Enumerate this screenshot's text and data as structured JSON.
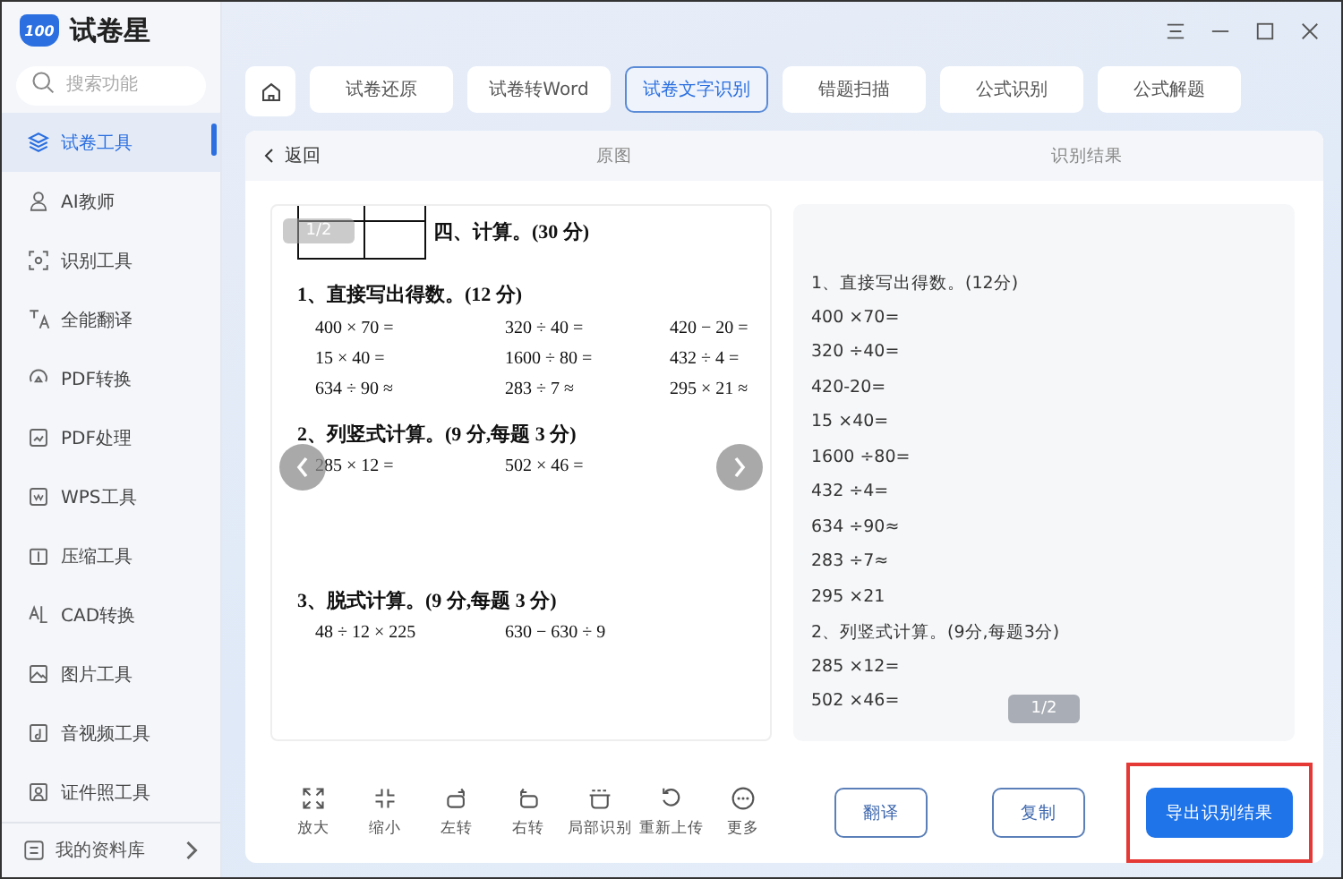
{
  "app": {
    "name": "试卷星",
    "logo_badge": "100"
  },
  "search": {
    "placeholder": "搜索功能"
  },
  "sidebar": {
    "items": [
      {
        "label": "试卷工具",
        "selected": true
      },
      {
        "label": "AI教师",
        "selected": false
      },
      {
        "label": "识别工具",
        "selected": false
      },
      {
        "label": "全能翻译",
        "selected": false
      },
      {
        "label": "PDF转换",
        "selected": false
      },
      {
        "label": "PDF处理",
        "selected": false
      },
      {
        "label": "WPS工具",
        "selected": false
      },
      {
        "label": "压缩工具",
        "selected": false
      },
      {
        "label": "CAD转换",
        "selected": false
      },
      {
        "label": "图片工具",
        "selected": false
      },
      {
        "label": "音视频工具",
        "selected": false
      },
      {
        "label": "证件照工具",
        "selected": false
      }
    ],
    "footer": "我的资料库"
  },
  "tabs": [
    {
      "label": "试卷还原",
      "selected": false
    },
    {
      "label": "试卷转Word",
      "selected": false
    },
    {
      "label": "试卷文字识别",
      "selected": true
    },
    {
      "label": "错题扫描",
      "selected": false
    },
    {
      "label": "公式识别",
      "selected": false
    },
    {
      "label": "公式解题",
      "selected": false
    }
  ],
  "panel": {
    "back": "返回",
    "left_title": "原图",
    "right_title": "识别结果"
  },
  "original": {
    "page_badge": "1/2",
    "heading": "四、计算。(30 分)",
    "sections": [
      {
        "title": "1、直接写出得数。(12 分)",
        "rows": [
          [
            "400 × 70 =",
            "320 ÷ 40 =",
            "420 − 20 ="
          ],
          [
            "15 × 40 =",
            "1600 ÷ 80 =",
            "432 ÷ 4 ="
          ],
          [
            "634 ÷ 90 ≈",
            "283 ÷ 7 ≈",
            "295 × 21 ≈"
          ]
        ]
      },
      {
        "title": "2、列竖式计算。(9 分,每题 3 分)",
        "rows": [
          [
            "285 × 12 =",
            "502 × 46 ="
          ]
        ]
      },
      {
        "title": "3、脱式计算。(9 分,每题 3 分)",
        "rows": [
          [
            "48 ÷ 12 × 225",
            "630 − 630 ÷ 9"
          ]
        ]
      }
    ]
  },
  "result": {
    "lines": [
      "1、直接写出得数。(12分)",
      "400 ×70=",
      "320 ÷40=",
      "420-20=",
      "15 ×40=",
      "1600 ÷80=",
      "432 ÷4=",
      "634 ÷90≈",
      "283 ÷7≈",
      "295 ×21",
      "2、列竖式计算。(9分,每题3分)",
      "285 ×12=",
      "502 ×46="
    ],
    "page_badge": "1/2"
  },
  "tools": [
    "放大",
    "缩小",
    "左转",
    "右转",
    "局部识别",
    "重新上传",
    "更多"
  ],
  "actions": [
    {
      "label": "翻译",
      "kind": "outline"
    },
    {
      "label": "复制",
      "kind": "outline"
    },
    {
      "label": "导出识别结果",
      "kind": "primary",
      "highlighted": true
    }
  ]
}
